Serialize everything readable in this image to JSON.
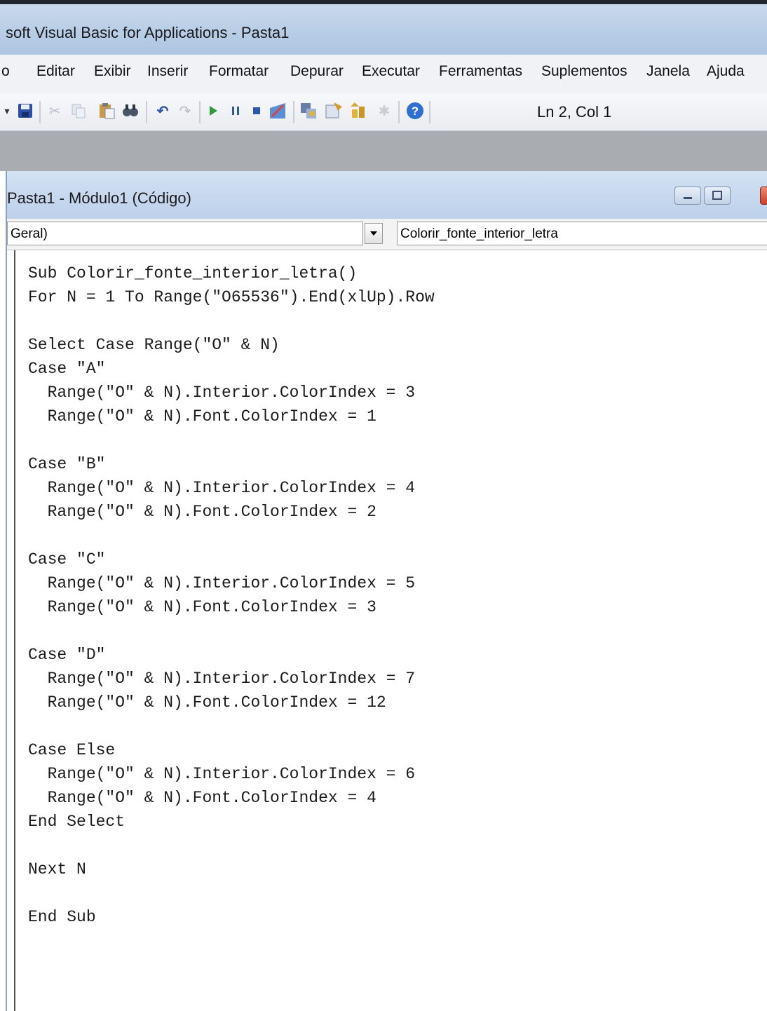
{
  "window": {
    "title": "soft Visual Basic for Applications - Pasta1"
  },
  "menu": [
    "o",
    "Editar",
    "Exibir",
    "Inserir",
    "Formatar",
    "Depurar",
    "Executar",
    "Ferramentas",
    "Suplementos",
    "Janela",
    "Ajuda"
  ],
  "toolbar": {
    "icons": [
      "dropdown-arrow-icon",
      "save-icon",
      "cut-icon",
      "copy-icon",
      "paste-icon",
      "find-icon",
      "undo-icon",
      "redo-icon",
      "run-icon",
      "pause-icon",
      "stop-icon",
      "design-mode-icon",
      "project-explorer-icon",
      "properties-icon",
      "object-browser-icon",
      "toolbox-icon",
      "help-icon"
    ],
    "status": "Ln 2, Col 1"
  },
  "code_window": {
    "title": "Pasta1 - Módulo1 (Código)",
    "object_combo": "Geral)",
    "procedure_combo": "Colorir_fonte_interior_letra"
  },
  "code": [
    "Sub Colorir_fonte_interior_letra()",
    "For N = 1 To Range(\"O65536\").End(xlUp).Row",
    "",
    "Select Case Range(\"O\" & N)",
    "Case \"A\"",
    "  Range(\"O\" & N).Interior.ColorIndex = 3",
    "  Range(\"O\" & N).Font.ColorIndex = 1",
    "",
    "Case \"B\"",
    "  Range(\"O\" & N).Interior.ColorIndex = 4",
    "  Range(\"O\" & N).Font.ColorIndex = 2",
    "",
    "Case \"C\"",
    "  Range(\"O\" & N).Interior.ColorIndex = 5",
    "  Range(\"O\" & N).Font.ColorIndex = 3",
    "",
    "Case \"D\"",
    "  Range(\"O\" & N).Interior.ColorIndex = 7",
    "  Range(\"O\" & N).Font.ColorIndex = 12",
    "",
    "Case Else",
    "  Range(\"O\" & N).Interior.ColorIndex = 6",
    "  Range(\"O\" & N).Font.ColorIndex = 4",
    "End Select",
    "",
    "Next N",
    "",
    "End Sub"
  ]
}
